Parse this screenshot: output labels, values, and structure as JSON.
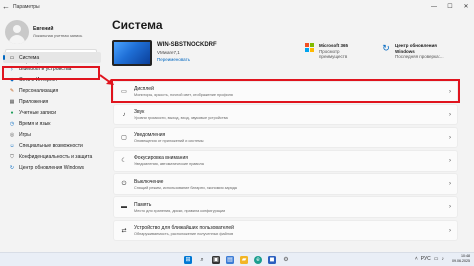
{
  "window": {
    "title": "Параметры",
    "back_icon": "arrow-left-icon",
    "minimize": "—",
    "maximize": "☐",
    "close": "✕"
  },
  "profile": {
    "name": "Евгений",
    "account_type": "Локальная учетная запись"
  },
  "search": {
    "placeholder": "Найти параметр",
    "icon": "search-icon"
  },
  "sidebar": {
    "items": [
      {
        "label": "Система",
        "icon": "monitor-icon",
        "active": true
      },
      {
        "label": "Bluetooth и устройства",
        "icon": "bluetooth-icon"
      },
      {
        "label": "Сеть и Интернет",
        "icon": "wifi-icon"
      },
      {
        "label": "Персонализация",
        "icon": "brush-icon"
      },
      {
        "label": "Приложения",
        "icon": "apps-icon"
      },
      {
        "label": "Учетные записи",
        "icon": "person-icon"
      },
      {
        "label": "Время и язык",
        "icon": "clock-icon"
      },
      {
        "label": "Игры",
        "icon": "gamepad-icon"
      },
      {
        "label": "Специальные возможности",
        "icon": "accessibility-icon"
      },
      {
        "label": "Конфиденциальность и защита",
        "icon": "shield-icon"
      },
      {
        "label": "Центр обновления Windows",
        "icon": "update-icon"
      }
    ]
  },
  "main": {
    "title": "Система",
    "device": {
      "name": "WIN-SBSTNOCKDRF",
      "model": "VMware7,1",
      "rename": "Переименовать"
    },
    "microsoft365": {
      "title": "Microsoft 365",
      "line2": "Просмотр",
      "line3": "преимуществ"
    },
    "windows_update": {
      "title": "Центр обновления",
      "line2": "Windows",
      "line3": "Последняя проверка:..."
    },
    "settings": [
      {
        "title": "Дисплей",
        "desc": "Мониторы, яркость, ночной свет, отображение профиля",
        "icon": "display-icon"
      },
      {
        "title": "Звук",
        "desc": "Уровни громкости, выход, вход, звуковые устройства",
        "icon": "speaker-icon"
      },
      {
        "title": "Уведомления",
        "desc": "Оповещения от приложений и системы",
        "icon": "bell-icon"
      },
      {
        "title": "Фокусировка внимания",
        "desc": "Уведомления, автоматические правила",
        "icon": "moon-icon"
      },
      {
        "title": "Выключение",
        "desc": "Спящий режим, использование батареи, экономия заряда",
        "icon": "power-icon"
      },
      {
        "title": "Память",
        "desc": "Место для хранения, диски, правила конфигурации",
        "icon": "storage-icon"
      },
      {
        "title": "Устройство для ближайших пользователей",
        "desc": "Обнаруживаемость, расположение полученных файлов",
        "icon": "share-icon"
      }
    ]
  },
  "taskbar": {
    "icons": [
      "windows-start-icon",
      "search-icon",
      "task-view-icon",
      "widgets-icon",
      "file-explorer-icon",
      "edge-icon",
      "store-icon",
      "settings-gear-icon"
    ],
    "time": "10:48",
    "date": "09.06.2025",
    "lang": "РУС"
  },
  "colors": {
    "accent": "#0067c0",
    "highlight_red": "#e0141e"
  }
}
